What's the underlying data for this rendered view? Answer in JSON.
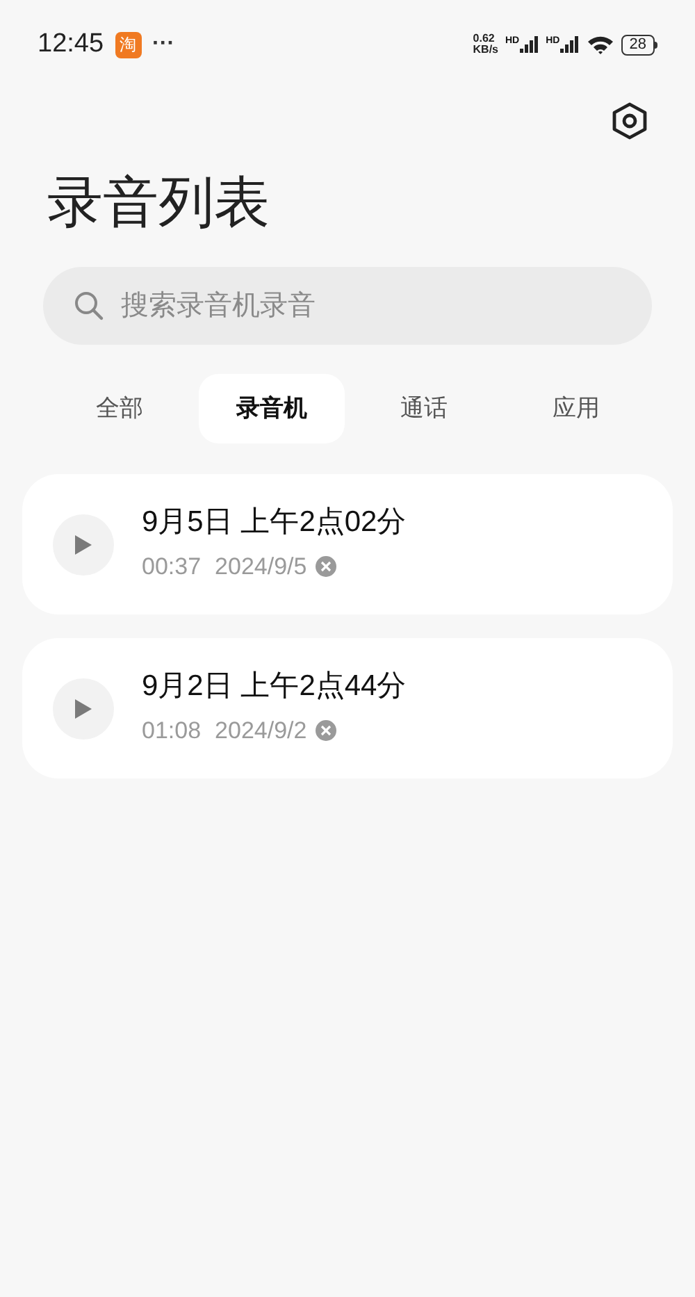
{
  "status_bar": {
    "time": "12:45",
    "app_badge": "淘",
    "more": "···",
    "speed_value": "0.62",
    "speed_unit": "KB/s",
    "sim_labels": [
      "HD",
      "HD"
    ],
    "battery": "28"
  },
  "title": "录音列表",
  "search": {
    "placeholder": "搜索录音机录音"
  },
  "tabs": [
    {
      "label": "全部",
      "selected": false
    },
    {
      "label": "录音机",
      "selected": true
    },
    {
      "label": "通话",
      "selected": false
    },
    {
      "label": "应用",
      "selected": false
    }
  ],
  "recordings": [
    {
      "title": "9月5日 上午2点02分",
      "duration": "00:37",
      "date": "2024/9/5"
    },
    {
      "title": "9月2日 上午2点44分",
      "duration": "01:08",
      "date": "2024/9/2"
    }
  ]
}
